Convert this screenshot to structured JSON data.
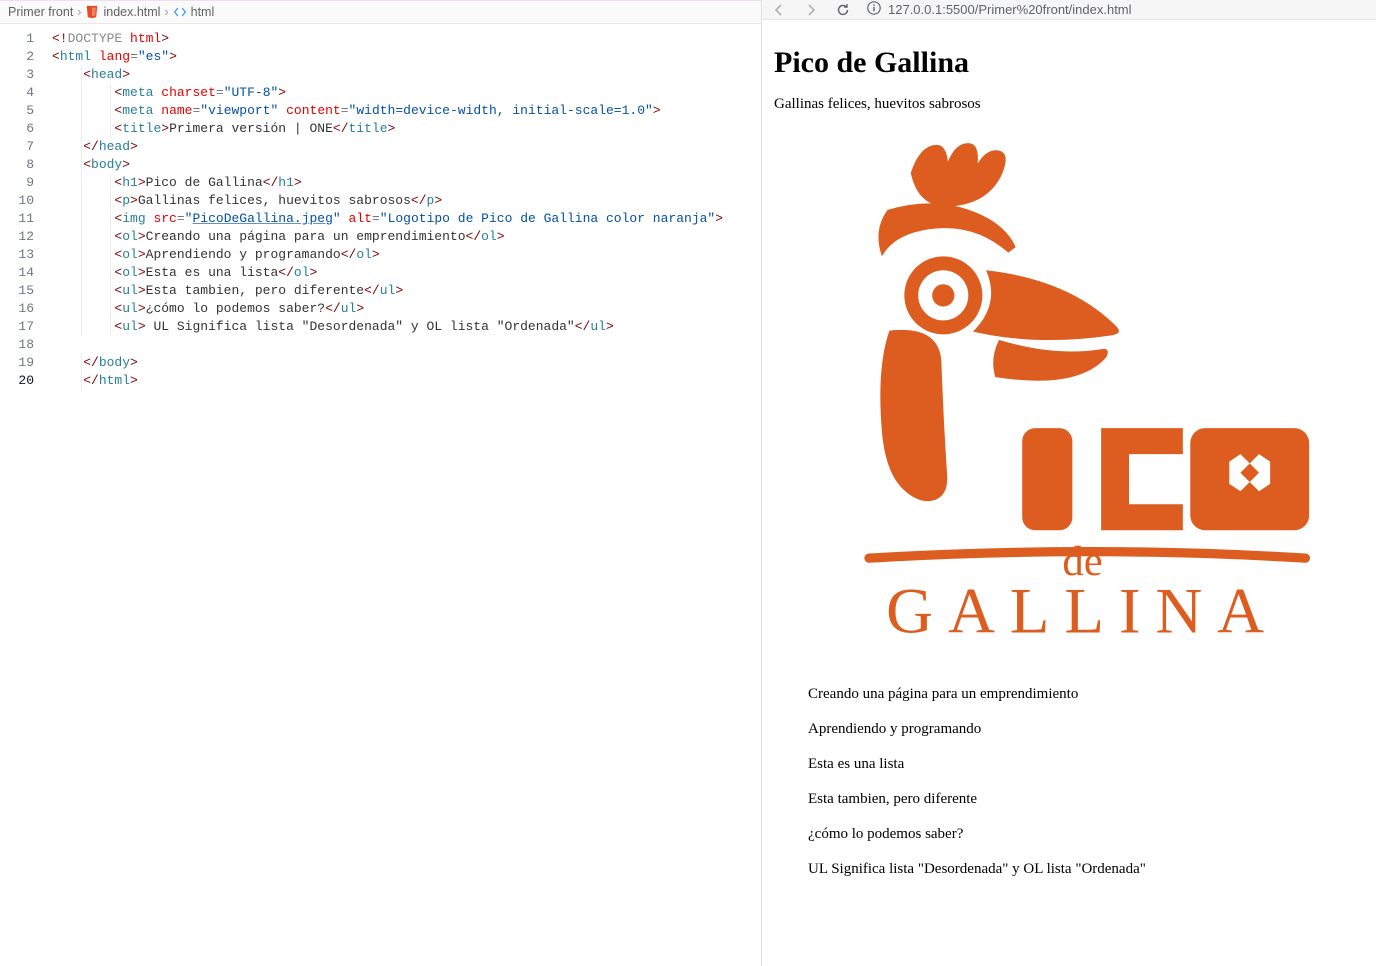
{
  "breadcrumb": {
    "folder": "Primer front",
    "file": "index.html",
    "symbol": "html"
  },
  "browser": {
    "url": "127.0.0.1:5500/Primer%20front/index.html"
  },
  "editor": {
    "active_line": 20,
    "lines": [
      {
        "n": 1,
        "tokens": [
          [
            "<!",
            "ang"
          ],
          [
            "DOCTYPE",
            "doctype"
          ],
          [
            " ",
            "txt"
          ],
          [
            "html",
            "attr"
          ],
          [
            ">",
            "ang"
          ]
        ]
      },
      {
        "n": 2,
        "tokens": [
          [
            "<",
            "ang"
          ],
          [
            "html",
            "tag"
          ],
          [
            " ",
            "txt"
          ],
          [
            "lang",
            "attr"
          ],
          [
            "=",
            "punc"
          ],
          [
            "\"es\"",
            "val"
          ],
          [
            ">",
            "ang"
          ]
        ]
      },
      {
        "n": 3,
        "tokens": [
          [
            "<",
            "ang"
          ],
          [
            "head",
            "tag"
          ],
          [
            ">",
            "ang"
          ]
        ],
        "indent": 1
      },
      {
        "n": 4,
        "tokens": [
          [
            "<",
            "ang"
          ],
          [
            "meta",
            "tag"
          ],
          [
            " ",
            "txt"
          ],
          [
            "charset",
            "attr"
          ],
          [
            "=",
            "punc"
          ],
          [
            "\"UTF-8\"",
            "val"
          ],
          [
            ">",
            "ang"
          ]
        ],
        "indent": 2
      },
      {
        "n": 5,
        "tokens": [
          [
            "<",
            "ang"
          ],
          [
            "meta",
            "tag"
          ],
          [
            " ",
            "txt"
          ],
          [
            "name",
            "attr"
          ],
          [
            "=",
            "punc"
          ],
          [
            "\"viewport\"",
            "val"
          ],
          [
            " ",
            "txt"
          ],
          [
            "content",
            "attr"
          ],
          [
            "=",
            "punc"
          ],
          [
            "\"width=device-width, initial-scale=1.0\"",
            "val"
          ],
          [
            ">",
            "ang"
          ]
        ],
        "indent": 2
      },
      {
        "n": 6,
        "tokens": [
          [
            "<",
            "ang"
          ],
          [
            "title",
            "tag"
          ],
          [
            ">",
            "ang"
          ],
          [
            "Primera versión | ONE",
            "txt"
          ],
          [
            "</",
            "ang"
          ],
          [
            "title",
            "tag"
          ],
          [
            ">",
            "ang"
          ]
        ],
        "indent": 2
      },
      {
        "n": 7,
        "tokens": [
          [
            "</",
            "ang"
          ],
          [
            "head",
            "tag"
          ],
          [
            ">",
            "ang"
          ]
        ],
        "indent": 1
      },
      {
        "n": 8,
        "tokens": [
          [
            "<",
            "ang"
          ],
          [
            "body",
            "tag"
          ],
          [
            ">",
            "ang"
          ]
        ],
        "indent": 1
      },
      {
        "n": 9,
        "tokens": [
          [
            "<",
            "ang"
          ],
          [
            "h1",
            "tag"
          ],
          [
            ">",
            "ang"
          ],
          [
            "Pico de Gallina",
            "txt"
          ],
          [
            "</",
            "ang"
          ],
          [
            "h1",
            "tag"
          ],
          [
            ">",
            "ang"
          ]
        ],
        "indent": 2
      },
      {
        "n": 10,
        "tokens": [
          [
            "<",
            "ang"
          ],
          [
            "p",
            "tag"
          ],
          [
            ">",
            "ang"
          ],
          [
            "Gallinas felices, huevitos sabrosos",
            "txt"
          ],
          [
            "</",
            "ang"
          ],
          [
            "p",
            "tag"
          ],
          [
            ">",
            "ang"
          ]
        ],
        "indent": 2
      },
      {
        "n": 11,
        "tokens": [
          [
            "<",
            "ang"
          ],
          [
            "img",
            "tag"
          ],
          [
            " ",
            "txt"
          ],
          [
            "src",
            "attr"
          ],
          [
            "=",
            "punc"
          ],
          [
            "\"",
            "val"
          ],
          [
            "PicoDeGallina.jpeg",
            "link"
          ],
          [
            "\"",
            "val"
          ],
          [
            " ",
            "txt"
          ],
          [
            "alt",
            "attr"
          ],
          [
            "=",
            "punc"
          ],
          [
            "\"Logotipo de Pico de Gallina color naranja\"",
            "val"
          ],
          [
            ">",
            "ang"
          ]
        ],
        "indent": 2
      },
      {
        "n": 12,
        "tokens": [
          [
            "<",
            "ang"
          ],
          [
            "ol",
            "ol"
          ],
          [
            ">",
            "ang"
          ],
          [
            "Creando una página para un emprendimiento",
            "txt"
          ],
          [
            "</",
            "ang"
          ],
          [
            "ol",
            "ol"
          ],
          [
            ">",
            "ang"
          ]
        ],
        "indent": 2
      },
      {
        "n": 13,
        "tokens": [
          [
            "<",
            "ang"
          ],
          [
            "ol",
            "ol"
          ],
          [
            ">",
            "ang"
          ],
          [
            "Aprendiendo y programando",
            "txt"
          ],
          [
            "</",
            "ang"
          ],
          [
            "ol",
            "ol"
          ],
          [
            ">",
            "ang"
          ]
        ],
        "indent": 2
      },
      {
        "n": 14,
        "tokens": [
          [
            "<",
            "ang"
          ],
          [
            "ol",
            "ol"
          ],
          [
            ">",
            "ang"
          ],
          [
            "Esta es una lista",
            "txt"
          ],
          [
            "</",
            "ang"
          ],
          [
            "ol",
            "ol"
          ],
          [
            ">",
            "ang"
          ]
        ],
        "indent": 2
      },
      {
        "n": 15,
        "tokens": [
          [
            "<",
            "ang"
          ],
          [
            "ul",
            "ol"
          ],
          [
            ">",
            "ang"
          ],
          [
            "Esta tambien, pero diferente",
            "txt"
          ],
          [
            "</",
            "ang"
          ],
          [
            "ul",
            "ol"
          ],
          [
            ">",
            "ang"
          ]
        ],
        "indent": 2
      },
      {
        "n": 16,
        "tokens": [
          [
            "<",
            "ang"
          ],
          [
            "ul",
            "ol"
          ],
          [
            ">",
            "ang"
          ],
          [
            "¿cómo lo podemos saber?",
            "txt"
          ],
          [
            "</",
            "ang"
          ],
          [
            "ul",
            "ol"
          ],
          [
            ">",
            "ang"
          ]
        ],
        "indent": 2
      },
      {
        "n": 17,
        "tokens": [
          [
            "<",
            "ang"
          ],
          [
            "ul",
            "ol"
          ],
          [
            ">",
            "ang"
          ],
          [
            " UL Significa lista \"Desordenada\" y OL lista \"Ordenada\"",
            "txt"
          ],
          [
            "</",
            "ang"
          ],
          [
            "ul",
            "ol"
          ],
          [
            ">",
            "ang"
          ]
        ],
        "indent": 2
      },
      {
        "n": 18,
        "tokens": [],
        "indent": 0
      },
      {
        "n": 19,
        "tokens": [
          [
            "</",
            "ang"
          ],
          [
            "body",
            "tag"
          ],
          [
            ">",
            "ang"
          ]
        ],
        "indent": 1
      },
      {
        "n": 20,
        "tokens": [
          [
            "</",
            "ang"
          ],
          [
            "html",
            "tag"
          ],
          [
            ">",
            "ang"
          ]
        ],
        "indent": 1
      }
    ]
  },
  "page": {
    "h1": "Pico de Gallina",
    "subtitle": "Gallinas felices, huevitos sabrosos",
    "logo_word": "GALLINA",
    "logo_de": "de",
    "lists": [
      "Creando una página para un emprendimiento",
      "Aprendiendo y programando",
      "Esta es una lista",
      "Esta tambien, pero diferente",
      "¿cómo lo podemos saber?",
      "UL Significa lista \"Desordenada\" y OL lista \"Ordenada\""
    ]
  }
}
